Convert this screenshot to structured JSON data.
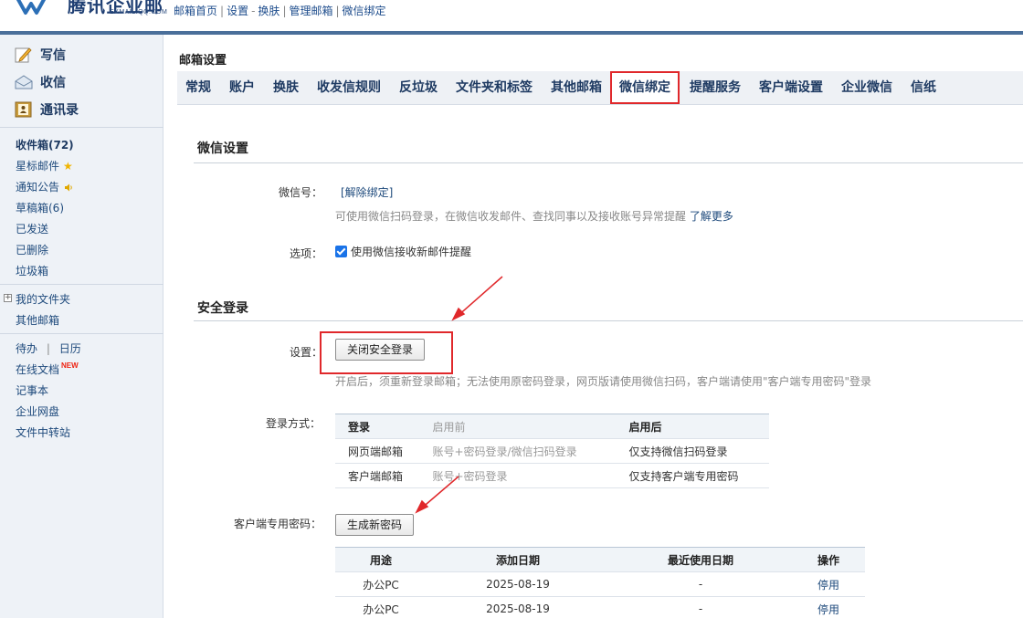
{
  "header": {
    "logo_text": "腾讯企业邮",
    "logo_sub": "EXMAIL.QQ.COM",
    "links": [
      "邮箱首页",
      "设置",
      "换肤",
      "管理邮箱",
      "微信绑定"
    ],
    "sep_bar": "|",
    "sep_dash": "-"
  },
  "sidebar": {
    "compose": "写信",
    "inbox": "收信",
    "contacts": "通讯录",
    "folders": [
      "收件箱(72)",
      "星标邮件",
      "通知公告",
      "草稿箱(6)",
      "已发送",
      "已删除",
      "垃圾箱"
    ],
    "my_folders": "我的文件夹",
    "plus": "+",
    "other_mailbox": "其他邮箱",
    "todo": "待办",
    "todo_sep": "|",
    "calendar": "日历",
    "online_docs": "在线文档",
    "new_badge": "NEW",
    "notes": "记事本",
    "netdisk": "企业网盘",
    "transfer": "文件中转站",
    "star_glyph": "★"
  },
  "main": {
    "page_title": "邮箱设置",
    "tabs": [
      "常规",
      "账户",
      "换肤",
      "收发信规则",
      "反垃圾",
      "文件夹和标签",
      "其他邮箱",
      "微信绑定",
      "提醒服务",
      "客户端设置",
      "企业微信",
      "信纸"
    ],
    "active_tab_index": 7,
    "wechat_section": "微信设置",
    "wechat_id_label": "微信号：",
    "unbind_link": "[解除绑定]",
    "wechat_hint": "可使用微信扫码登录，在微信收发邮件、查找同事以及接收账号异常提醒",
    "learn_more": "了解更多",
    "option_label": "选项：",
    "option_text": "使用微信接收新邮件提醒",
    "option_checked": true,
    "security_section": "安全登录",
    "setting_label": "设置：",
    "close_secure_btn": "关闭安全登录",
    "secure_hint": "开启后，须重新登录邮箱；无法使用原密码登录，网页版请使用微信扫码，客户端请使用\"客户端专用密码\"登录",
    "login_method_label": "登录方式：",
    "login_table": {
      "headers": [
        "登录",
        "启用前",
        "启用后"
      ],
      "rows": [
        [
          "网页端邮箱",
          "账号+密码登录/微信扫码登录",
          "仅支持微信扫码登录"
        ],
        [
          "客户端邮箱",
          "账号+密码登录",
          "仅支持客户端专用密码"
        ]
      ]
    },
    "client_pw_label": "客户端专用密码：",
    "gen_pw_btn": "生成新密码",
    "pw_table": {
      "headers": [
        "用途",
        "添加日期",
        "最近使用日期",
        "操作"
      ],
      "rows": [
        [
          "办公PC",
          "2025-08-19",
          "-",
          "停用"
        ],
        [
          "办公PC",
          "2025-08-19",
          "-",
          "停用"
        ]
      ]
    }
  },
  "colors": {
    "highlight": "#e0282b",
    "nav_text": "#1e3a62",
    "link": "#1e4a7c"
  }
}
